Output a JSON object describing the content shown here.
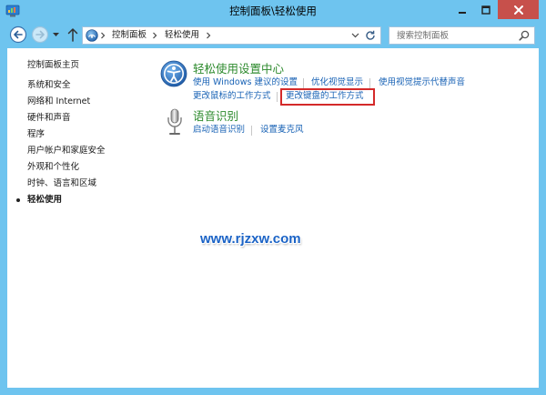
{
  "window": {
    "title": "控制面板\\轻松使用",
    "app_icon": "control-panel-icon",
    "buttons": [
      "minimize-icon",
      "maximize-icon",
      "close-icon"
    ]
  },
  "navigation": {
    "back_icon": "back-arrow-icon",
    "forward_icon": "forward-arrow-icon",
    "forward_enabled": false,
    "recent_icon": "chevron-down-icon",
    "up_icon": "up-arrow-icon"
  },
  "address_bar": {
    "icon": "control-panel-icon",
    "breadcrumb": [
      {
        "label": "控制面板"
      },
      {
        "label": "轻松使用"
      }
    ],
    "dropdown_icon": "chevron-down-icon",
    "refresh_icon": "refresh-icon"
  },
  "search": {
    "placeholder": "搜索控制面板",
    "value": "",
    "icon": "search-icon"
  },
  "sidebar": {
    "home": "控制面板主页",
    "items": [
      {
        "label": "系统和安全",
        "selected": false
      },
      {
        "label": "网络和 Internet",
        "selected": false
      },
      {
        "label": "硬件和声音",
        "selected": false
      },
      {
        "label": "程序",
        "selected": false
      },
      {
        "label": "用户帐户和家庭安全",
        "selected": false
      },
      {
        "label": "外观和个性化",
        "selected": false
      },
      {
        "label": "时钟、语言和区域",
        "selected": false
      },
      {
        "label": "轻松使用",
        "selected": true
      }
    ]
  },
  "sections": [
    {
      "icon": "ease-of-access-icon",
      "title": "轻松使用设置中心",
      "links": [
        "使用 Windows 建议的设置",
        "优化视觉显示",
        "使用视觉提示代替声音",
        "更改鼠标的工作方式",
        "更改键盘的工作方式"
      ]
    },
    {
      "icon": "microphone-icon",
      "title": "语音识别",
      "links": [
        "启动语音识别",
        "设置麦克风"
      ]
    }
  ],
  "watermark": "www.rjzxw.com",
  "colors": {
    "frame": "#6ec4ef",
    "close_button": "#c7504b",
    "heading": "#2d8a2d",
    "link": "#1862b5",
    "highlight_box": "#d42a2a",
    "watermark": "#1b63c6"
  }
}
